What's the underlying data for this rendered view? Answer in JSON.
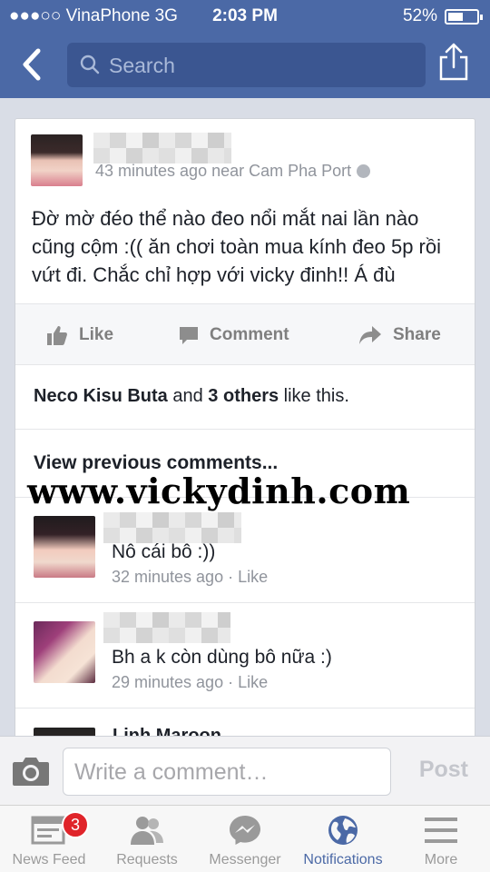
{
  "status_bar": {
    "carrier": "●●●○○ VinaPhone 3G",
    "time": "2:03 PM",
    "battery": "52%",
    "battery_level": 0.52
  },
  "nav": {
    "search_placeholder": "Search"
  },
  "post": {
    "meta": "43 minutes ago near Cam Pha Port",
    "text": "Đờ mờ đéo thể nào đeo nổi mắt nai lần nào cũng cộm :(( ăn chơi toàn mua kính đeo 5p rồi vứt đi. Chắc chỉ hợp với vicky đinh!! Á đù",
    "actions": {
      "like": "Like",
      "comment": "Comment",
      "share": "Share"
    },
    "likes": {
      "name": "Neco Kisu Buta",
      "and": " and ",
      "others": "3 others",
      "suffix": " like this."
    },
    "view_previous": "View previous comments..."
  },
  "watermark": "www.vickydinh.com",
  "comments": [
    {
      "text": "Nô cái bô :))",
      "time": "32 minutes ago",
      "sep": " · ",
      "like": "Like"
    },
    {
      "text": "Bh a k còn dùng bô nữa :)",
      "time": "29 minutes ago",
      "sep": " · ",
      "like": "Like"
    }
  ],
  "partial_comment_name": "Linh Maroon",
  "composer": {
    "placeholder": "Write a comment…",
    "post_label": "Post"
  },
  "tabs": [
    {
      "label": "News Feed",
      "badge": "3"
    },
    {
      "label": "Requests"
    },
    {
      "label": "Messenger"
    },
    {
      "label": "Notifications"
    },
    {
      "label": "More"
    }
  ],
  "colors": {
    "brand": "#4b69a6",
    "badge": "#e0242a"
  }
}
